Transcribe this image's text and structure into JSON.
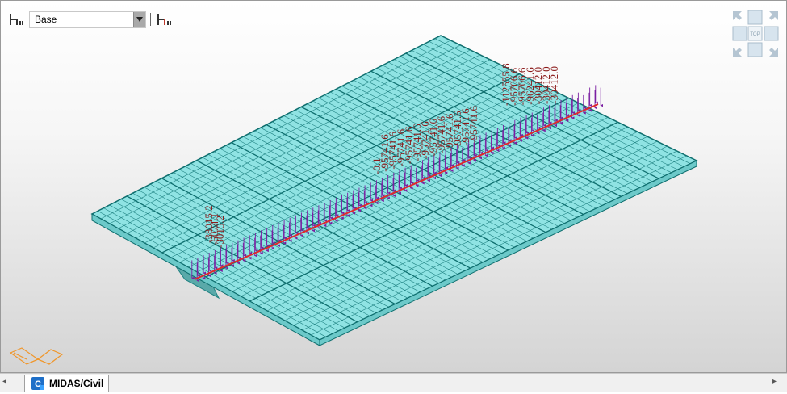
{
  "toolbar": {
    "layer_icon": "structure-layer-icon",
    "layer_select_value": "Base",
    "dropdown_icon": "dropdown-arrow-icon",
    "layer_toggle_icon": "structure-layer-toggle-icon"
  },
  "view_cube": {
    "top_label": "TOP",
    "icons": [
      "arrow-nw-icon",
      "arrow-ne-icon",
      "arrow-sw-icon",
      "arrow-se-icon"
    ]
  },
  "colors": {
    "mesh_fill": "#8fe3e3",
    "mesh_line": "#1f8282",
    "beam_line": "#0e6e6e",
    "load_arrow": "#7b1fa2",
    "result_text": "#8b1a1a",
    "centerline": "#e0282c",
    "triad": "#f0962a"
  },
  "result_labels": {
    "group_left": [
      "-38015.2",
      "-6074.1",
      "-3015.2"
    ],
    "group_mid": [
      "-0.1",
      "-95741.6",
      "-95741.6",
      "-95741.6",
      "-95741.6",
      "-95741.6",
      "-95741.6",
      "-95741.6",
      "-95741.6",
      "-95741.6",
      "-95741.6",
      "-95741.6",
      "-95741.6"
    ],
    "group_right": [
      "-112555.8",
      "-95706.6",
      "-95706.6",
      "-96241.6",
      "-30412.0",
      "-30412.0",
      "-30412.0"
    ]
  },
  "tabs": {
    "left_arrow": "◂",
    "right_arrow": "▸",
    "active_tab": "MIDAS/Civil",
    "tab_icon": "midas-civil-logo-icon"
  }
}
